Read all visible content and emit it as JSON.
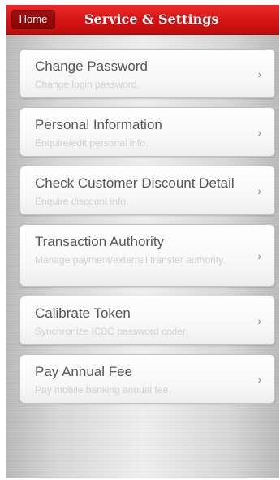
{
  "header": {
    "home_label": "Home",
    "title": "Service & Settings"
  },
  "menu": {
    "items": [
      {
        "id": "change-password",
        "title": "Change Password",
        "description": "Change login password."
      },
      {
        "id": "personal-information",
        "title": "Personal Information",
        "description": "Enquire/edit personal info."
      },
      {
        "id": "check-customer-discount-detail",
        "title": "Check Customer Discount Detail",
        "description": "Enquire discount info."
      },
      {
        "id": "transaction-authority",
        "title": "Transaction Authority",
        "description": "Manage payment/external transfer authority."
      },
      {
        "id": "calibrate-token",
        "title": "Calibrate Token",
        "description": "Synchronize ICBC password coder"
      },
      {
        "id": "pay-annual-fee",
        "title": "Pay Annual Fee",
        "description": "Pay mobile banking annual fee."
      }
    ],
    "chevron_glyph": "›"
  },
  "colors": {
    "brand_red": "#d41414",
    "home_button": "#960a0a",
    "item_title": "#555555",
    "item_description": "#d0d0d0"
  },
  "icons": {
    "item_arrow": "chevron-right-icon"
  }
}
